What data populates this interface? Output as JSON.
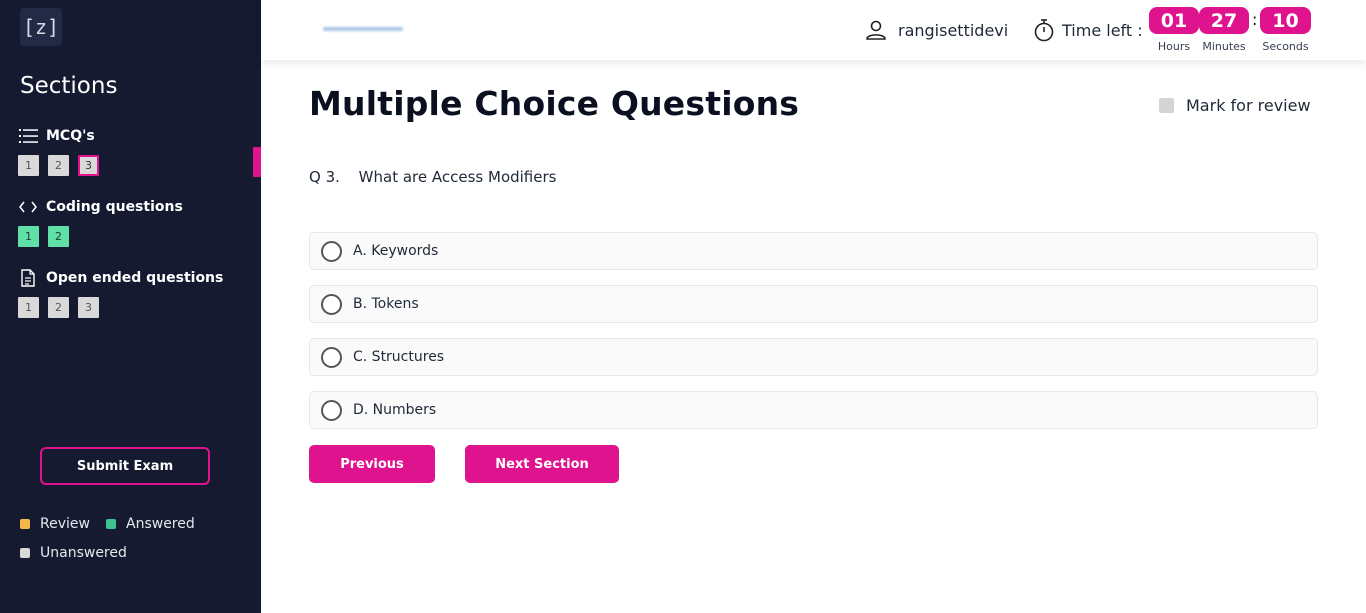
{
  "logo": {
    "text": "[z]"
  },
  "sidebar": {
    "title": "Sections",
    "sections": [
      {
        "label": "MCQ's",
        "icon": "list-icon",
        "questions": [
          {
            "num": "1",
            "state": "unanswered"
          },
          {
            "num": "2",
            "state": "unanswered"
          },
          {
            "num": "3",
            "state": "current"
          }
        ]
      },
      {
        "label": "Coding questions",
        "icon": "code-icon",
        "questions": [
          {
            "num": "1",
            "state": "answered"
          },
          {
            "num": "2",
            "state": "answered"
          }
        ]
      },
      {
        "label": "Open ended questions",
        "icon": "document-icon",
        "questions": [
          {
            "num": "1",
            "state": "unanswered"
          },
          {
            "num": "2",
            "state": "unanswered"
          },
          {
            "num": "3",
            "state": "unanswered"
          }
        ]
      }
    ],
    "submit_label": "Submit Exam",
    "legend": [
      {
        "label": "Review",
        "color": "#f6b84b"
      },
      {
        "label": "Answered",
        "color": "#3ec28f"
      },
      {
        "label": "Unanswered",
        "color": "#d9d9d9"
      }
    ]
  },
  "header": {
    "username": "rangisettidevi",
    "time_left_label": "Time left :",
    "timer": [
      {
        "value": "01",
        "label": "Hours"
      },
      {
        "value": "27",
        "label": "Minutes"
      },
      {
        "value": "10",
        "label": "Seconds"
      }
    ]
  },
  "main": {
    "title": "Multiple Choice Questions",
    "mark_review_label": "Mark for review",
    "question_number": "Q 3.",
    "question_text": "What are Access Modifiers",
    "options": [
      "A. Keywords",
      "B. Tokens",
      "C. Structures",
      "D. Numbers"
    ],
    "previous_label": "Previous",
    "next_label": "Next Section"
  },
  "colors": {
    "accent": "#e0138f",
    "sidebar_bg": "#151a30",
    "answered": "#5fe0a6"
  }
}
